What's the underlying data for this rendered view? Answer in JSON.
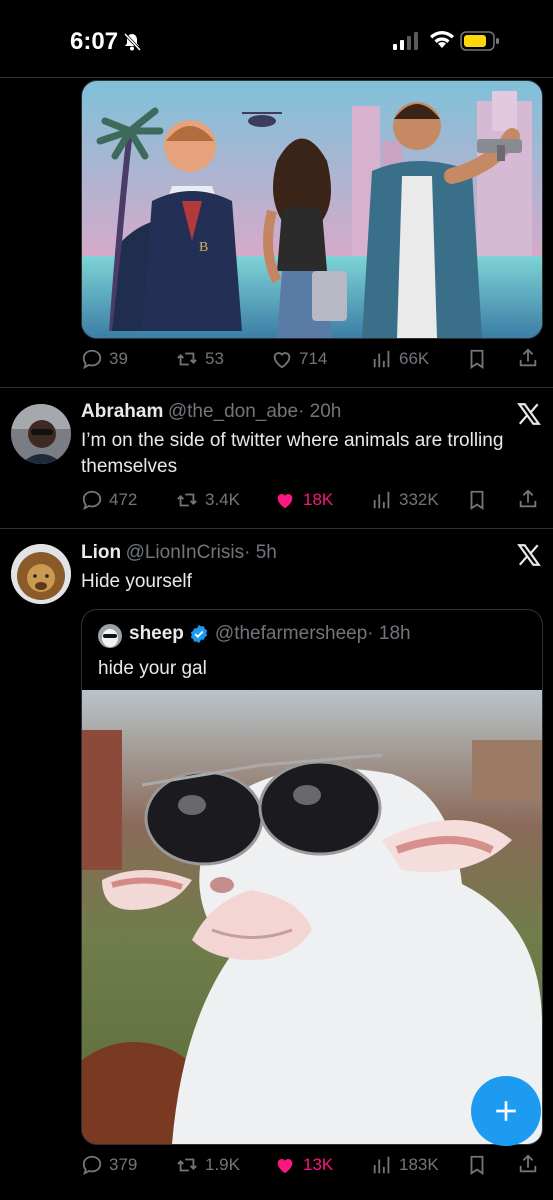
{
  "status_bar": {
    "time": "6:07"
  },
  "tweets": [
    {
      "actions": {
        "replies": "39",
        "retweets": "53",
        "likes": "714",
        "views": "66K"
      }
    },
    {
      "name": "Abraham",
      "handle": "@the_don_abe",
      "time": "· 20h",
      "text_line1": "I’m on the side of twitter where animals are trolling",
      "text_line2": "themselves",
      "actions": {
        "replies": "472",
        "retweets": "3.4K",
        "likes": "18K",
        "views": "332K"
      }
    },
    {
      "name": "Lion",
      "handle": "@LionInCrisis",
      "time": "· 5h",
      "text": "Hide yourself",
      "quote": {
        "name": "sheep",
        "handle": "@thefarmersheep",
        "time": "· 18h",
        "text": "hide your gal"
      },
      "actions": {
        "replies": "379",
        "retweets": "1.9K",
        "likes": "13K",
        "views": "183K"
      }
    }
  ],
  "colors": {
    "accent": "#1d9bf0",
    "like": "#f91880",
    "muted": "#71767b"
  },
  "icons": [
    "bell-slash-icon",
    "signal-icon",
    "wifi-icon",
    "battery-icon",
    "reply-icon",
    "retweet-icon",
    "heart-icon",
    "views-icon",
    "bookmark-icon",
    "share-icon",
    "x-logo-icon",
    "verified-badge-icon",
    "compose-plus-icon"
  ]
}
